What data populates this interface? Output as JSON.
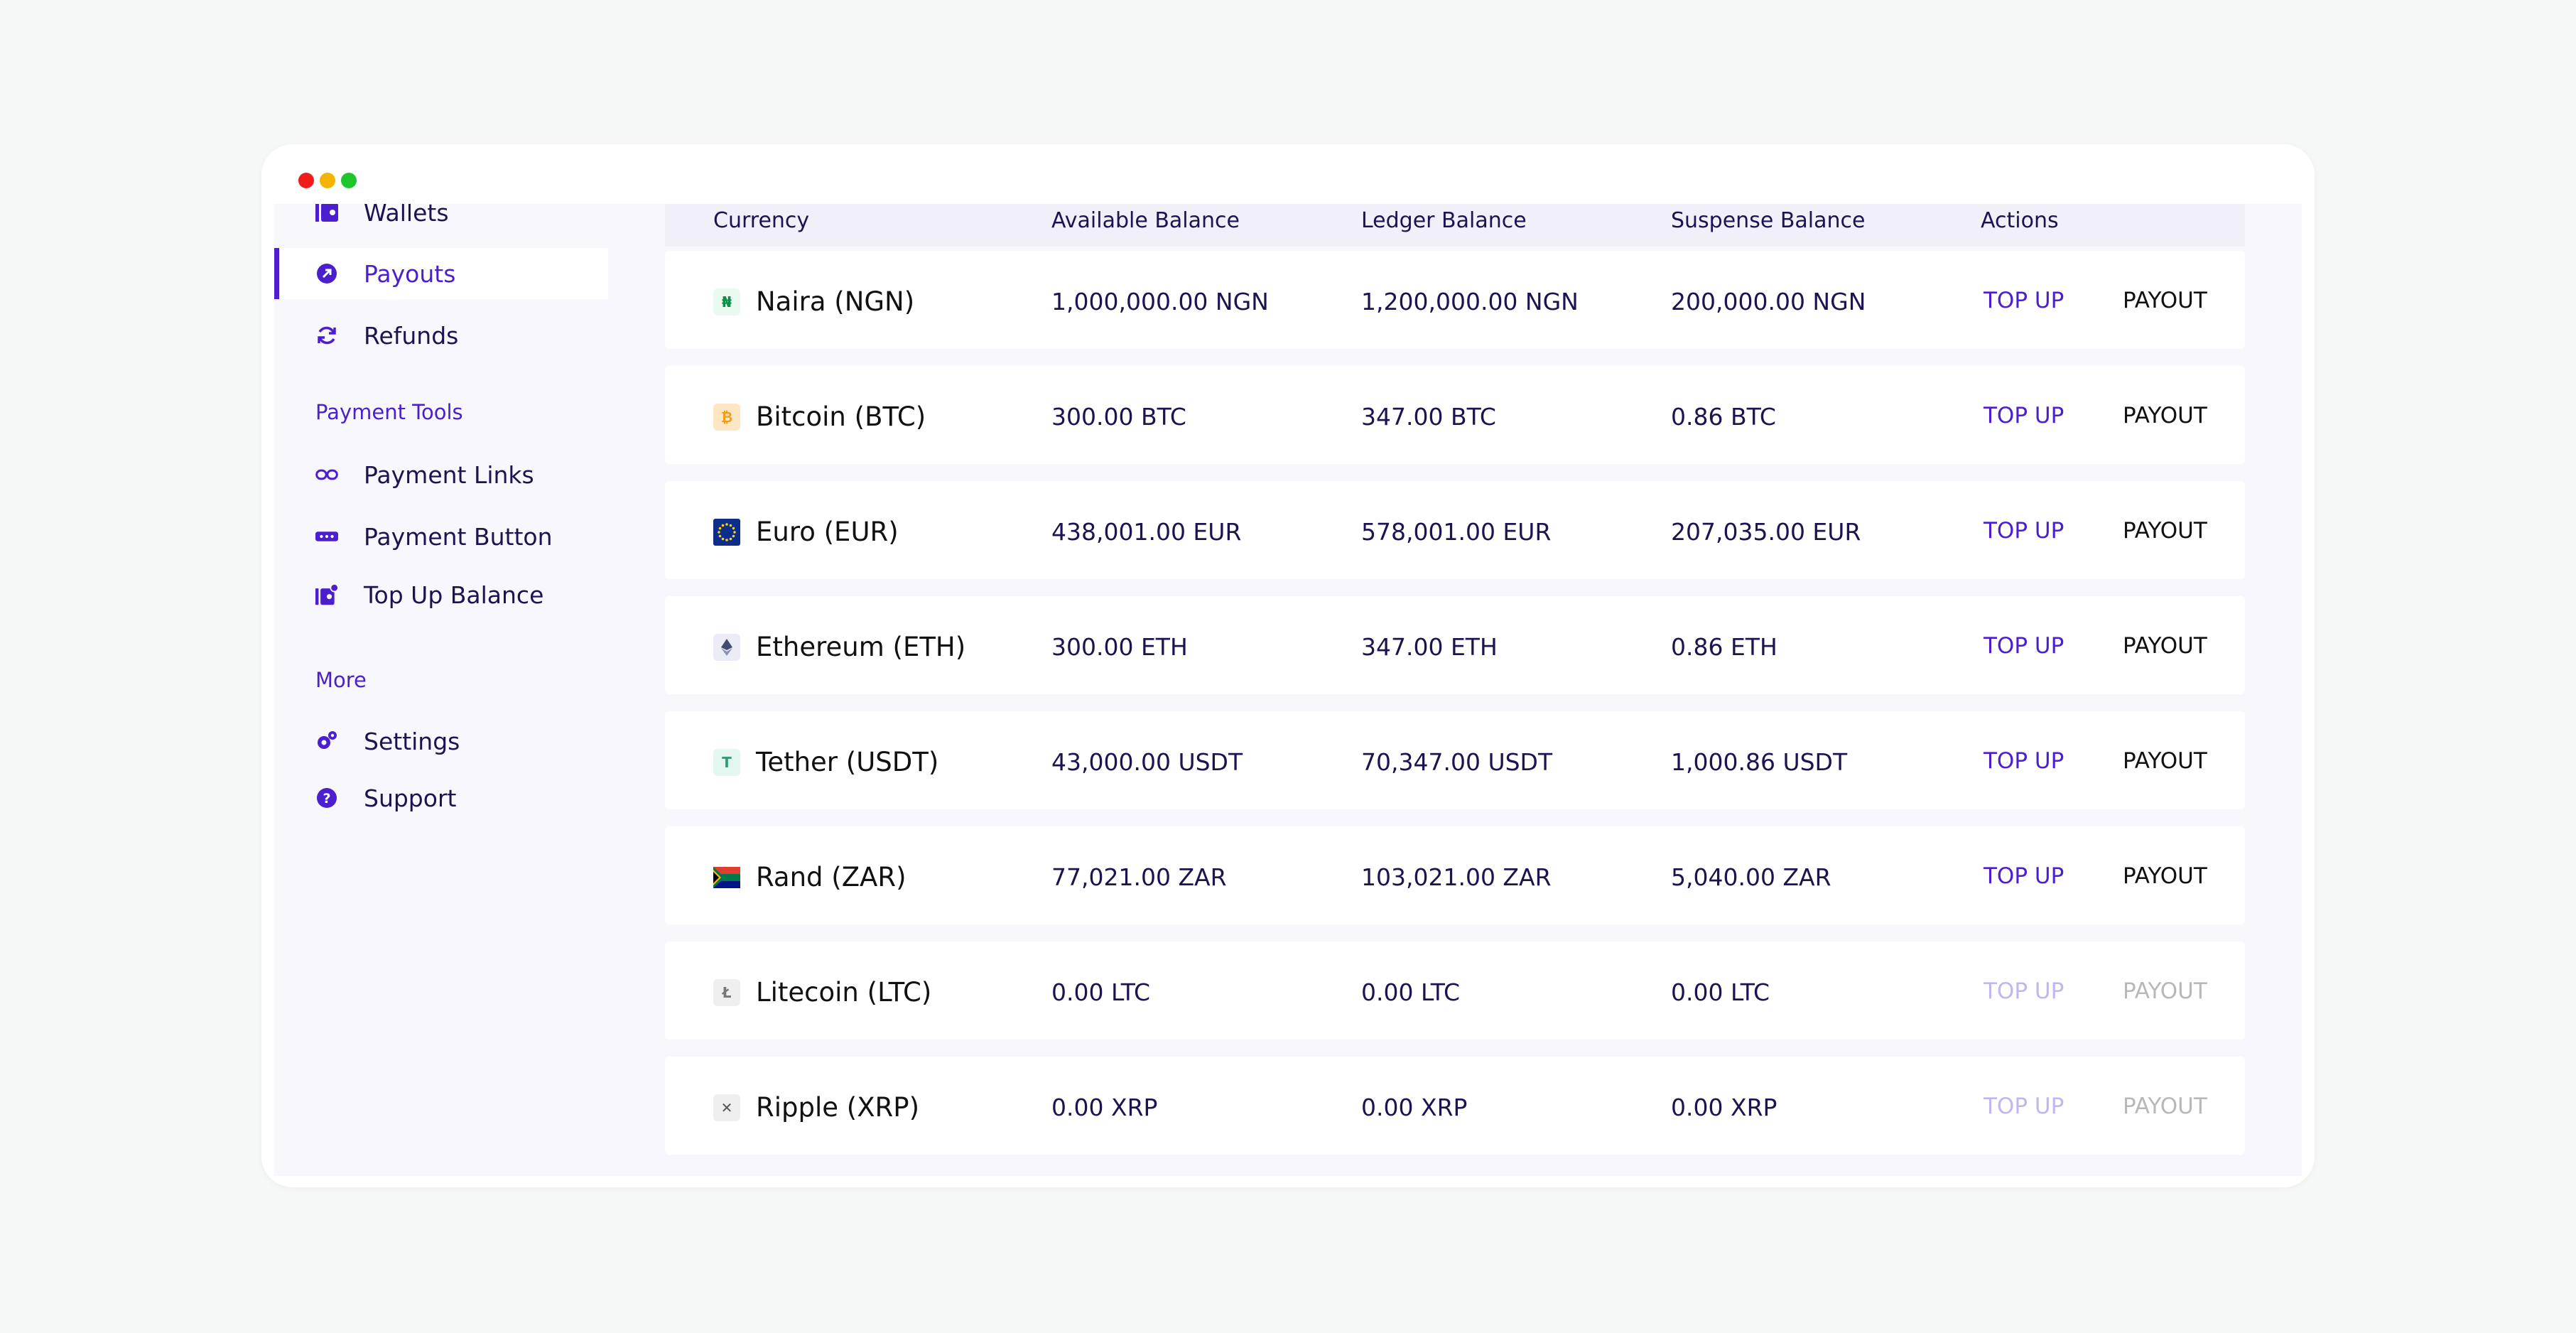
{
  "sidebar": {
    "items": [
      {
        "label": "Wallets",
        "icon": "wallet-icon"
      },
      {
        "label": "Payouts",
        "icon": "payout-icon",
        "active": true
      },
      {
        "label": "Refunds",
        "icon": "refresh-icon"
      }
    ],
    "sections": [
      {
        "title": "Payment Tools",
        "items": [
          {
            "label": "Payment Links",
            "icon": "link-icon"
          },
          {
            "label": "Payment Button",
            "icon": "button-icon"
          },
          {
            "label": "Top Up Balance",
            "icon": "wallet-plus-icon"
          }
        ]
      },
      {
        "title": "More",
        "items": [
          {
            "label": "Settings",
            "icon": "gear-icon"
          },
          {
            "label": "Support",
            "icon": "help-icon"
          }
        ]
      }
    ]
  },
  "table": {
    "headers": [
      "Currency",
      "Available Balance",
      "Ledger Balance",
      "Suspense Balance",
      "Actions"
    ],
    "actions": {
      "topup": "TOP UP",
      "payout": "PAYOUT"
    },
    "rows": [
      {
        "currency": "Naira (NGN)",
        "icon": "naira-icon",
        "available": "1,000,000.00 NGN",
        "ledger": "1,200,000.00 NGN",
        "suspense": "200,000.00 NGN",
        "enabled": true
      },
      {
        "currency": "Bitcoin (BTC)",
        "icon": "bitcoin-icon",
        "available": "300.00 BTC",
        "ledger": "347.00 BTC",
        "suspense": "0.86 BTC",
        "enabled": true
      },
      {
        "currency": "Euro (EUR)",
        "icon": "eu-flag-icon",
        "available": "438,001.00 EUR",
        "ledger": "578,001.00 EUR",
        "suspense": "207,035.00 EUR",
        "enabled": true
      },
      {
        "currency": "Ethereum (ETH)",
        "icon": "ethereum-icon",
        "available": "300.00 ETH",
        "ledger": "347.00 ETH",
        "suspense": "0.86 ETH",
        "enabled": true
      },
      {
        "currency": "Tether (USDT)",
        "icon": "tether-icon",
        "available": "43,000.00 USDT",
        "ledger": "70,347.00 USDT",
        "suspense": "1,000.86 USDT",
        "enabled": true
      },
      {
        "currency": "Rand (ZAR)",
        "icon": "south-africa-flag-icon",
        "available": "77,021.00 ZAR",
        "ledger": "103,021.00 ZAR",
        "suspense": "5,040.00 ZAR",
        "enabled": true
      },
      {
        "currency": "Litecoin (LTC)",
        "icon": "litecoin-icon",
        "available": "0.00 LTC",
        "ledger": "0.00 LTC",
        "suspense": "0.00 LTC",
        "enabled": false
      },
      {
        "currency": "Ripple (XRP)",
        "icon": "ripple-icon",
        "available": "0.00 XRP",
        "ledger": "0.00 XRP",
        "suspense": "0.00 XRP",
        "enabled": false
      }
    ]
  },
  "colors": {
    "accent": "#4b1fd0",
    "text": "#1b1450",
    "sidebar_bg": "#f8f7fd",
    "page_bg": "#f6f7f7"
  }
}
